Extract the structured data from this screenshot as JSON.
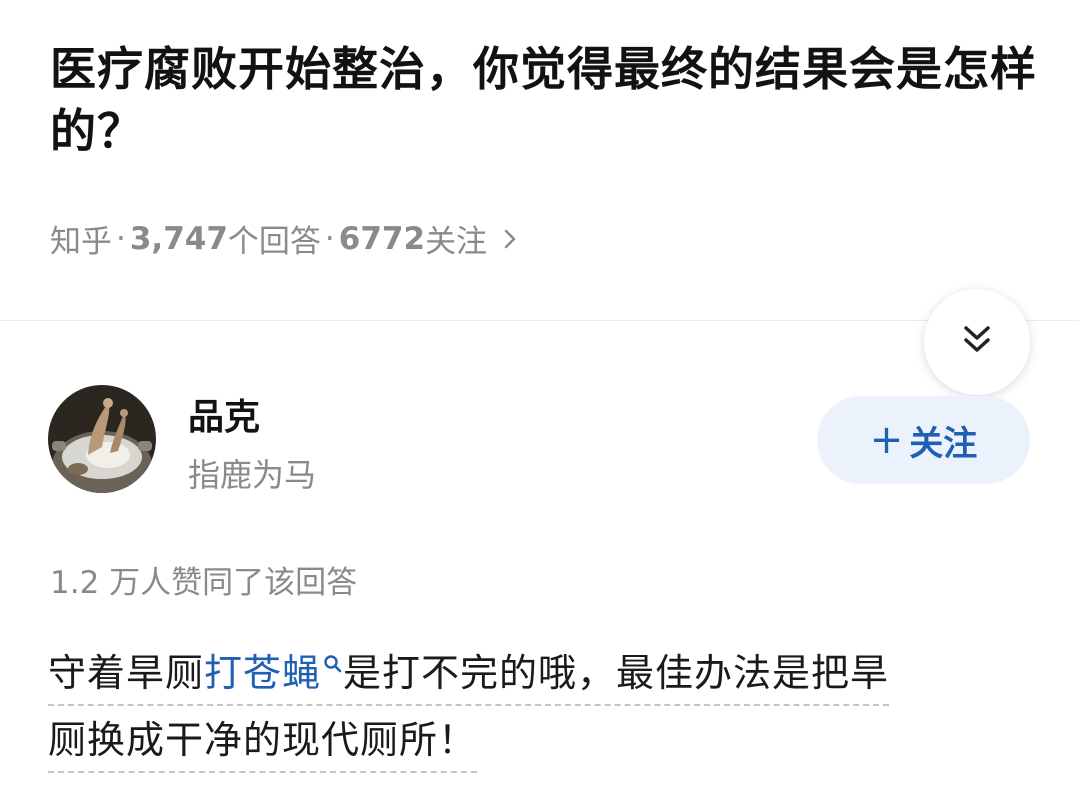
{
  "question": {
    "title": "医疗腐败开始整治，你觉得最终的结果会是怎样的？"
  },
  "meta": {
    "source": "知乎",
    "separator": "·",
    "answer_count": "3,747",
    "answer_label": " 个回答",
    "follower_count": "6772",
    "follower_label": " 关注"
  },
  "author": {
    "name": "品克",
    "bio": "指鹿为马",
    "follow_label": "关注",
    "follow_plus": "+"
  },
  "answer": {
    "upvote_text": "1.2 万人赞同了该回答",
    "line1_before": "守着旱厕",
    "keyword": "打苍蝇",
    "line1_after": "是打不完的哦，最佳办法是把旱",
    "line2": "厕换成干净的现代厕所！"
  },
  "colors": {
    "link_blue": "#1f5fb4",
    "follow_bg": "#ecf2fb",
    "meta_gray": "#8a8a8a"
  },
  "icons": {
    "meta_arrow": "chevron-right-icon",
    "collapse": "double-chevron-down-icon",
    "keyword_search": "search-icon"
  }
}
